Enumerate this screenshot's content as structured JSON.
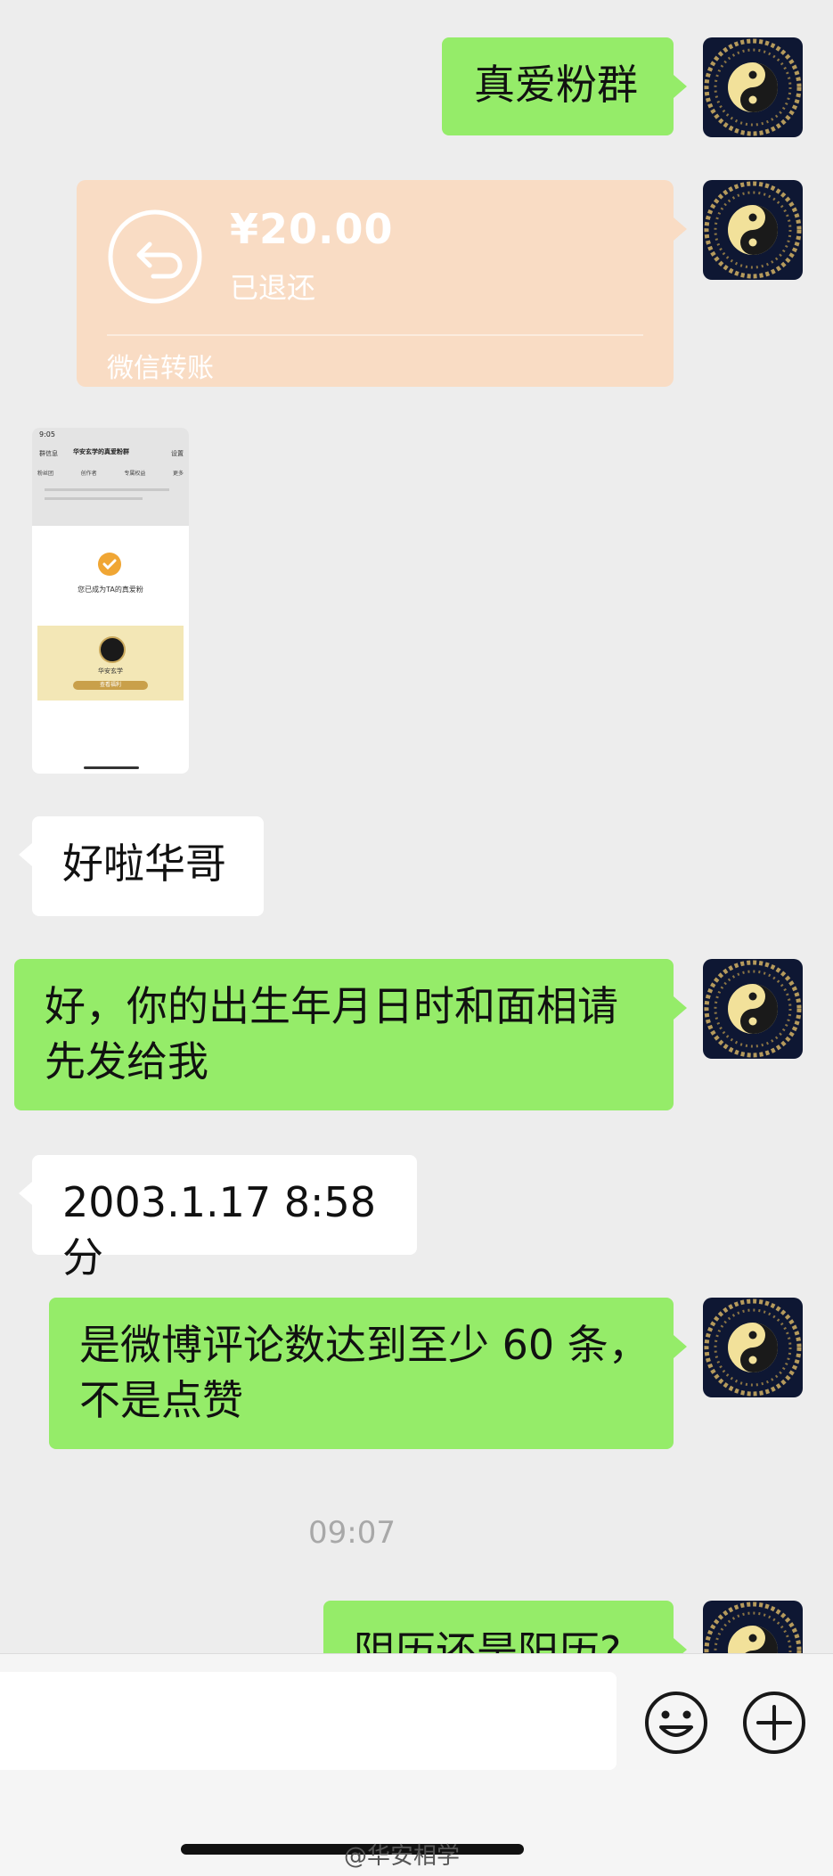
{
  "messages": [
    {
      "side": "right",
      "type": "text",
      "text": "真爱粉群"
    },
    {
      "side": "right",
      "type": "transfer",
      "amount": "¥20.00",
      "status": "已退还",
      "label": "微信转账"
    },
    {
      "side": "left",
      "type": "image",
      "description": "screenshot"
    },
    {
      "side": "left",
      "type": "text",
      "text": "好啦华哥"
    },
    {
      "side": "right",
      "type": "text",
      "lines": [
        "好，你的出生年月日时和面相请",
        "先发给我"
      ]
    },
    {
      "side": "left",
      "type": "text",
      "text": "2003.1.17 8:58分"
    },
    {
      "side": "right",
      "type": "text",
      "lines": [
        "是微博评论数达到至少 60 条，",
        "不是点赞"
      ]
    },
    {
      "side": "right",
      "type": "text",
      "text": "阴历还是阳历?"
    }
  ],
  "timestamp": "09:07",
  "thumbnail": {
    "time": "9:05",
    "back": "群信息",
    "title": "华安玄学的真爱粉群",
    "settings": "设置",
    "tiles": [
      "粉丝团",
      "创作者",
      "专属权益",
      "更多"
    ],
    "success_text": "您已成为TA的真爱粉",
    "account": "华安玄学",
    "button": "查看福利"
  },
  "input_bar": {
    "emoji_icon": "smiley-icon",
    "plus_icon": "plus-icon"
  },
  "watermark": "@华安相学",
  "colors": {
    "bubble_green": "#95ec69",
    "bubble_white": "#ffffff",
    "transfer": "#f9dcc4",
    "background": "#ededed"
  }
}
